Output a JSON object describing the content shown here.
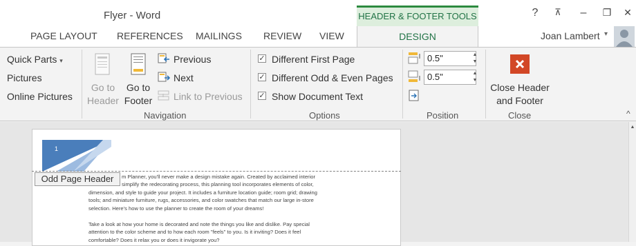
{
  "title_bar": {
    "doc_title": "Flyer - Word",
    "contextual_tab": "HEADER & FOOTER TOOLS",
    "help": "?",
    "ribbon_display": "⊼",
    "minimize": "–",
    "restore": "❐",
    "close": "✕"
  },
  "tabs": {
    "page_layout": "PAGE LAYOUT",
    "references": "REFERENCES",
    "mailings": "MAILINGS",
    "review": "REVIEW",
    "view": "VIEW",
    "design": "DESIGN"
  },
  "user": {
    "name": "Joan Lambert",
    "dropdown": "▾"
  },
  "insert_group": {
    "quick_parts": "Quick Parts",
    "quick_parts_arrow": "▾",
    "pictures": "Pictures",
    "online_pictures": "Online Pictures"
  },
  "navigation": {
    "go_to_header_line1": "Go to",
    "go_to_header_line2": "Header",
    "go_to_footer_line1": "Go to",
    "go_to_footer_line2": "Footer",
    "previous": "Previous",
    "next": "Next",
    "link_to_previous": "Link to Previous",
    "label": "Navigation"
  },
  "options": {
    "different_first_page": "Different First Page",
    "different_odd_even": "Different Odd & Even Pages",
    "show_document_text": "Show Document Text",
    "label": "Options"
  },
  "position": {
    "header_from_top": "0.5\"",
    "footer_from_bottom": "0.5\"",
    "label": "Position"
  },
  "close": {
    "line1": "Close Header",
    "line2": "and Footer",
    "label": "Close",
    "collapse": "^"
  },
  "document": {
    "page_number": "1",
    "odd_page_header": "Odd Page Header",
    "paragraph1": [
      "m Planner, you'll never make a design mistake again. Created by acclaimed interior",
      "simplify the redecorating process, this planning tool incorporates elements of color,",
      "dimension, and style to guide your project. It includes a furniture location guide; room grid; drawing",
      "tools; and miniature furniture, rugs, accessories, and color swatches that match our large in-store",
      "selection. Here's how to use the planner to create the room of your dreams!"
    ],
    "paragraph2": [
      "Take a look at how your home is decorated and note the things you like and dislike. Pay special",
      "attention to the color scheme and to how each room \"feels\" to you. Is it inviting? Does it feel",
      "comfortable? Does it relax you or does it invigorate you?"
    ]
  },
  "colors": {
    "accent_green": "#217346",
    "close_red": "#d24726",
    "header_blue": "#4a7ebb"
  }
}
